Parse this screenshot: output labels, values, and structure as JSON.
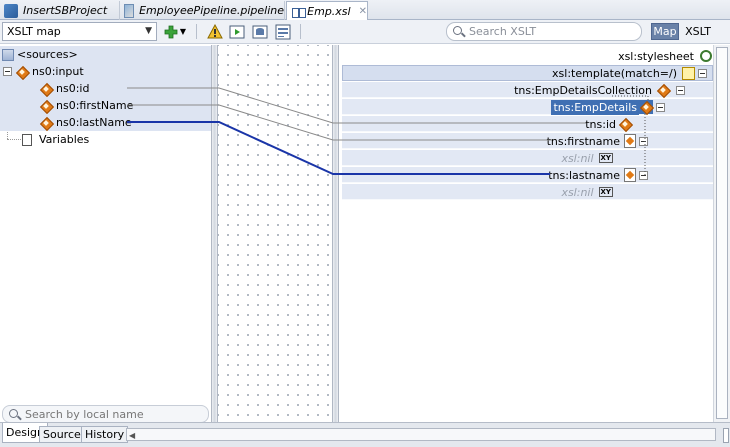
{
  "tabs": [
    {
      "label": "InsertSBProject",
      "icon": "project-icon",
      "active": false
    },
    {
      "label": "EmployeePipeline.pipeline",
      "icon": "pipeline-icon",
      "active": false
    },
    {
      "label": "Emp.xsl",
      "icon": "xsl-file-icon",
      "active": true
    }
  ],
  "toolbar": {
    "map_select_value": "XSLT map",
    "search_placeholder": "Search XSLT",
    "map_button": "Map",
    "xslt_button": "XSLT"
  },
  "source_tree": {
    "root": "<sources>",
    "input": "ns0:input",
    "fields": [
      "ns0:id",
      "ns0:firstName",
      "ns0:lastName"
    ],
    "variables": "Variables"
  },
  "source_search_placeholder": "Search by local name",
  "target_tree": {
    "stylesheet": "xsl:stylesheet",
    "template": "xsl:template(match=/)",
    "collection": "tns:EmpDetailsCollection",
    "element": "tns:EmpDetails",
    "id": "tns:id",
    "firstname": "tns:firstname",
    "nil1": "xsl:nil",
    "lastname": "tns:lastname",
    "nil2": "xsl:nil",
    "xy_label": "XY"
  },
  "bottom_tabs": [
    "Design",
    "Source",
    "History"
  ],
  "colors": {
    "accent": "#3f6fb3",
    "map_line_selected": "#1a35a8",
    "map_line": "#8a8a8a"
  }
}
